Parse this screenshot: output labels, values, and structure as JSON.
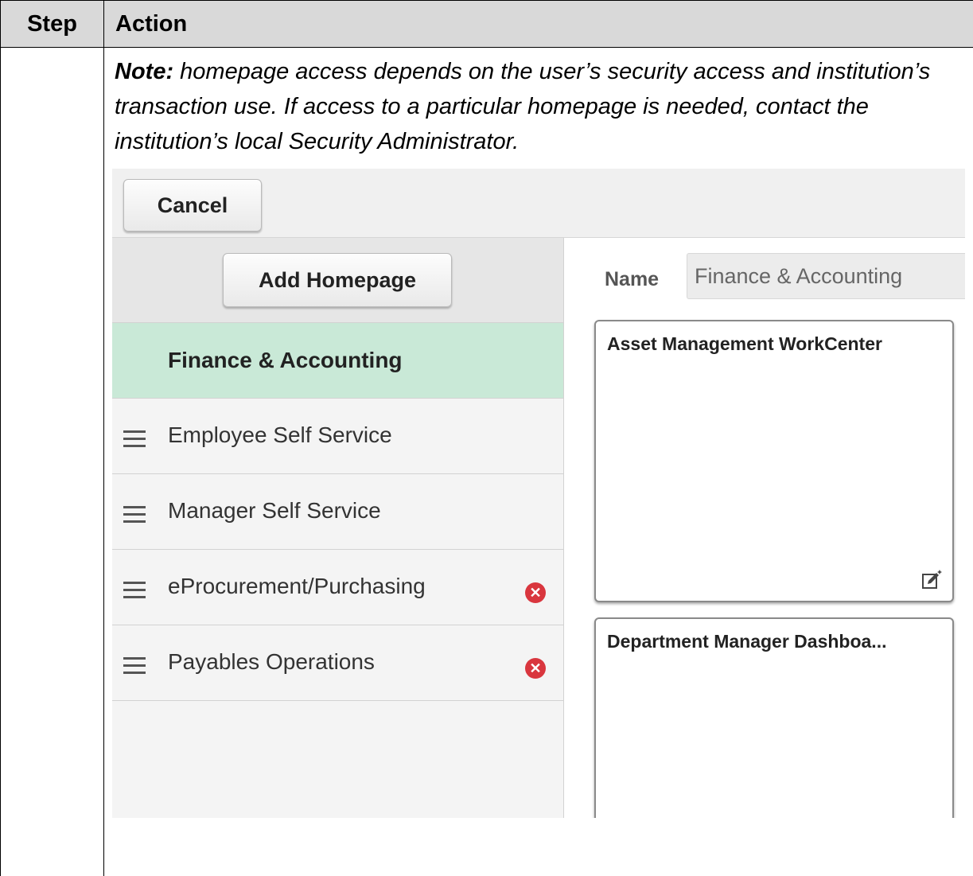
{
  "table": {
    "header_step": "Step",
    "header_action": "Action",
    "note_label": "Note:",
    "note_text": " homepage access depends on the user’s security access and institution’s transaction use. If access to a particular homepage is needed, contact the institution’s local Security Administrator."
  },
  "screenshot": {
    "cancel_label": "Cancel",
    "add_homepage_label": "Add Homepage",
    "homepages": [
      {
        "label": "Finance & Accounting",
        "active": true,
        "removable": false
      },
      {
        "label": "Employee Self Service",
        "active": false,
        "removable": false
      },
      {
        "label": "Manager Self Service",
        "active": false,
        "removable": false
      },
      {
        "label": "eProcurement/Purchasing",
        "active": false,
        "removable": true
      },
      {
        "label": "Payables Operations",
        "active": false,
        "removable": true
      }
    ],
    "name_label": "Name",
    "name_value": "Finance & Accounting",
    "tiles": [
      {
        "title": "Asset Management WorkCenter"
      },
      {
        "title": "Department Manager Dashboa..."
      }
    ],
    "icons": {
      "drag": "hamburger-icon",
      "remove": "remove-icon",
      "edit": "edit-icon"
    },
    "colors": {
      "active_item": "#c9e9d7",
      "remove": "#d9363e"
    }
  }
}
